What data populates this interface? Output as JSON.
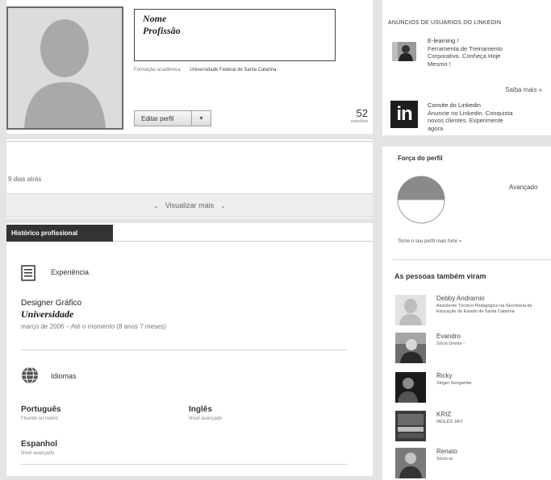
{
  "profile": {
    "name": "Nome",
    "profession": "Profissão",
    "education_label": "Formação acadêmica",
    "education_value": "Universidade Federal de Santa Catarina",
    "edit_button": "Editar perfil",
    "edit_caret": "▼",
    "connections_count": "52",
    "connections_label": "conexões"
  },
  "activity": {
    "time_ago": "9 dias atrás",
    "view_more": "Visualizar mais",
    "view_more_chevron": "⌄"
  },
  "history": {
    "tab_label": "Histórico profissional",
    "experience": {
      "heading": "Experiência",
      "icon": "document-icon",
      "job_title": "Designer Gráfico",
      "company": "Universidade",
      "period": "março de 2006 – Até o momento (8 anos 7 meses)"
    },
    "languages": {
      "heading": "Idiomas",
      "icon": "globe-icon",
      "items": [
        {
          "name": "Português",
          "level": "Fluente ou nativo"
        },
        {
          "name": "Inglês",
          "level": "Nível avançado"
        },
        {
          "name": "Espanhol",
          "level": "Nível avançado"
        }
      ]
    }
  },
  "ads": {
    "header": "ANÚNCIOS DE USUÁRIOS DO LINKEDIN",
    "items": [
      {
        "line1": "E-learning !",
        "line2": "Ferramenta de Treinamento",
        "line3": "Corporativo. Conheça Hoje",
        "line4": "Mesmo !"
      },
      {
        "line1": "Convite do Linkedin",
        "line2": "Anuncie no Linkedin. Conquista",
        "line3": "novos clientes. Experimente",
        "line4": "agora"
      }
    ],
    "learn_more": "Saiba mais »",
    "logo_text": "in"
  },
  "profile_strength": {
    "title": "Força do perfil",
    "level": "Avançado",
    "fill_fraction": 0.5,
    "tip": "Torne o seu perfil mais forte »"
  },
  "people_also_viewed": {
    "title": "As pessoas também viram",
    "people": [
      {
        "name": "Debby Andrarnio",
        "title": "Assistente Técnico Pedagógico na Secretaria de Educação do Estado de Santa Catarina"
      },
      {
        "name": "Evandro",
        "title": "Sócio Diretor -"
      },
      {
        "name": "Ricky",
        "title": "Singer-Songwriter"
      },
      {
        "name": "KRIZ",
        "title": "INGLÊS JÁ!!!"
      },
      {
        "name": "Renato",
        "title": "Sócio at"
      }
    ]
  },
  "colors": {
    "strength_fill": "#8a8a8a",
    "dark_tab": "#333333",
    "gap": "#e4e4e4"
  }
}
